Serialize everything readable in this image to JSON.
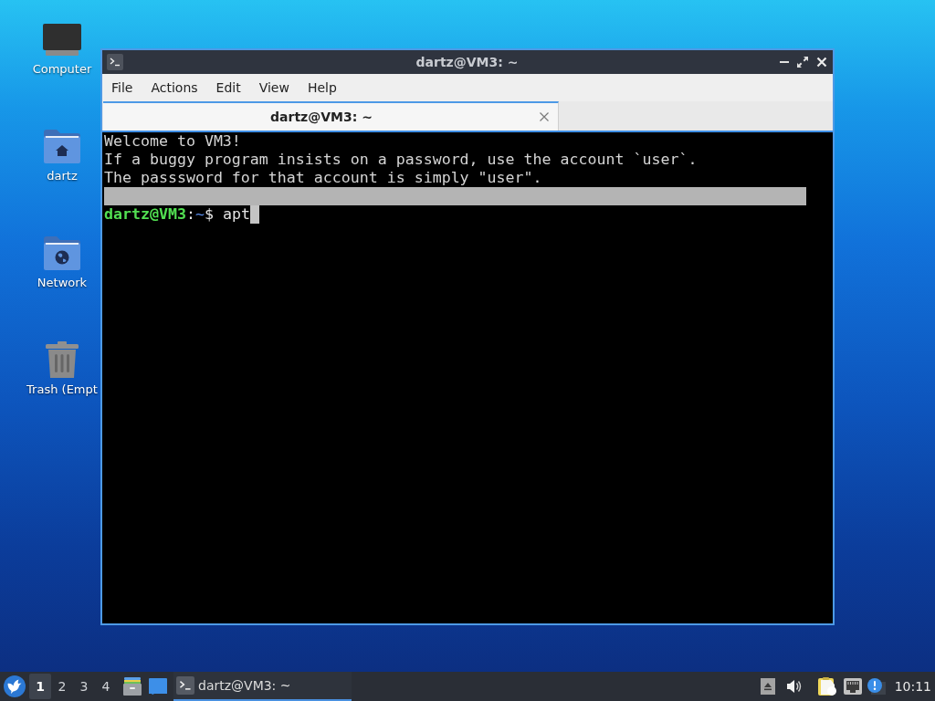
{
  "desktop": {
    "shortcuts": [
      {
        "kind": "computer",
        "label": "Computer"
      },
      {
        "kind": "home",
        "label": "dartz"
      },
      {
        "kind": "network",
        "label": "Network"
      },
      {
        "kind": "trash",
        "label": "Trash (Empt"
      }
    ]
  },
  "window": {
    "title": "dartz@VM3: ~",
    "menu": [
      "File",
      "Actions",
      "Edit",
      "View",
      "Help"
    ],
    "tabs": [
      {
        "label": "dartz@VM3: ~",
        "selected": true
      }
    ],
    "terminal": {
      "lines": [
        {
          "kind": "output",
          "text": "Welcome to VM3!",
          "selected": false
        },
        {
          "kind": "output",
          "text": "If a buggy program insists on a password, use the account `user`.",
          "selected": false
        },
        {
          "kind": "output",
          "text": "The passsword for that account is simply \"user\".",
          "selected": false
        },
        {
          "kind": "blank",
          "selected": true
        }
      ],
      "prompt": {
        "user": "dartz@VM3",
        "separator": ":",
        "path": "~",
        "command": "$ apt"
      }
    }
  },
  "taskbar": {
    "workspaces": [
      {
        "label": "1",
        "selected": true
      },
      {
        "label": "2",
        "selected": false
      },
      {
        "label": "3",
        "selected": false
      },
      {
        "label": "4",
        "selected": false
      }
    ],
    "tasks": [
      {
        "label": "dartz@VM3: ~",
        "selected": true
      }
    ],
    "clock": "10:11"
  }
}
